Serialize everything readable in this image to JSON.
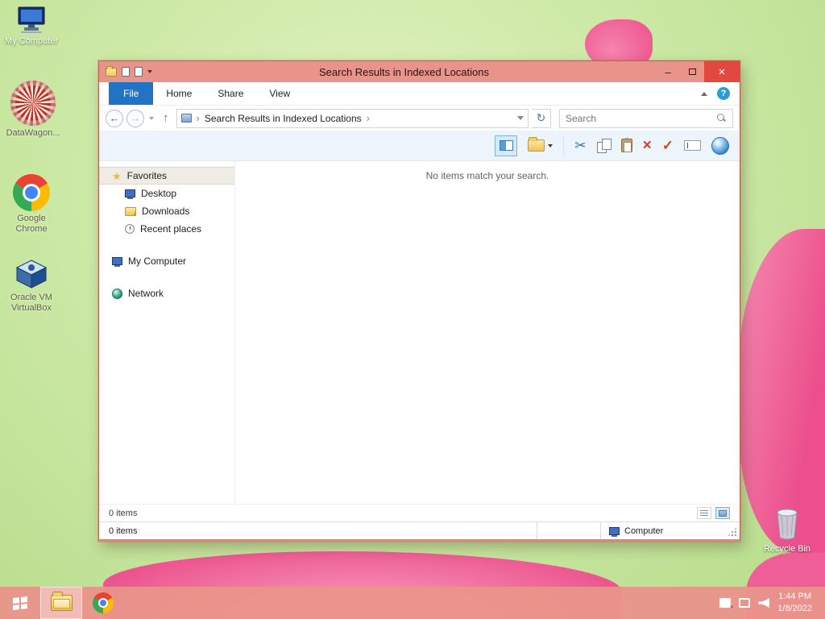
{
  "colors": {
    "chrome_accent": "#e9948a",
    "close_button": "#e1493e",
    "file_tab_blue": "#2173c6",
    "desktop_green": "#cde9a6",
    "flower_pink": "#ee4f8c"
  },
  "icons": {
    "star": "★",
    "cut": "✂",
    "check": "✓",
    "delete": "×",
    "close": "×",
    "minimize": "–",
    "breadcrumb_sep": "›",
    "refresh": "↻",
    "back": "←",
    "forward": "→",
    "up": "↑",
    "help": "?"
  },
  "desktop": {
    "icons": [
      {
        "label": "My Computer"
      },
      {
        "label": "DataWagon..."
      },
      {
        "label": "Google Chrome"
      },
      {
        "label": "Oracle VM VirtualBox"
      },
      {
        "label": "Recycle Bin"
      }
    ]
  },
  "window": {
    "title": "Search Results in Indexed Locations",
    "tabs": [
      {
        "label": "File"
      },
      {
        "label": "Home"
      },
      {
        "label": "Share"
      },
      {
        "label": "View"
      }
    ],
    "breadcrumb": "Search Results in Indexed Locations",
    "search_placeholder": "Search",
    "empty_message": "No items match your search.",
    "sidebar": {
      "favorites": {
        "label": "Favorites",
        "items": [
          "Desktop",
          "Downloads",
          "Recent places"
        ]
      },
      "my_computer": "My Computer",
      "network": "Network"
    },
    "status": {
      "items": "0 items"
    },
    "bottom_bar": {
      "items": "0 items",
      "location": "Computer"
    }
  },
  "taskbar": {
    "clock": {
      "time": "1:44 PM",
      "date": "1/8/2022"
    }
  }
}
